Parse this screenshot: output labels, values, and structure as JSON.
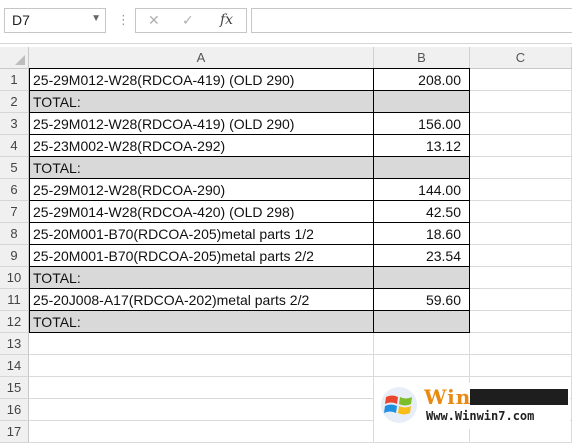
{
  "formula_bar": {
    "name_box": "D7",
    "cancel_symbol": "✕",
    "confirm_symbol": "✓",
    "fx_label": "fx",
    "formula": ""
  },
  "columns": [
    "A",
    "B",
    "C"
  ],
  "rows": [
    {
      "num": "1",
      "a": "25-29M012-W28(RDCOA-419)  (OLD 290)",
      "b": "208.00",
      "total": false
    },
    {
      "num": "2",
      "a": "TOTAL:",
      "b": "",
      "total": true
    },
    {
      "num": "3",
      "a": "25-29M012-W28(RDCOA-419)  (OLD 290)",
      "b": "156.00",
      "total": false
    },
    {
      "num": "4",
      "a": "25-23M002-W28(RDCOA-292)",
      "b": "13.12",
      "total": false
    },
    {
      "num": "5",
      "a": "TOTAL:",
      "b": "",
      "total": true
    },
    {
      "num": "6",
      "a": "25-29M012-W28(RDCOA-290)",
      "b": "144.00",
      "total": false
    },
    {
      "num": "7",
      "a": "25-29M014-W28(RDCOA-420) (OLD 298)",
      "b": "42.50",
      "total": false
    },
    {
      "num": "8",
      "a": "25-20M001-B70(RDCOA-205)metal parts 1/2",
      "b": "18.60",
      "total": false
    },
    {
      "num": "9",
      "a": "25-20M001-B70(RDCOA-205)metal parts 2/2",
      "b": "23.54",
      "total": false
    },
    {
      "num": "10",
      "a": "TOTAL:",
      "b": "",
      "total": true
    },
    {
      "num": "11",
      "a": "25-20J008-A17(RDCOA-202)metal parts 2/2",
      "b": "59.60",
      "total": false
    },
    {
      "num": "12",
      "a": "TOTAL:",
      "b": "",
      "total": true
    },
    {
      "num": "13",
      "a": "",
      "b": "",
      "total": false
    },
    {
      "num": "14",
      "a": "",
      "b": "",
      "total": false
    },
    {
      "num": "15",
      "a": "",
      "b": "",
      "total": false
    },
    {
      "num": "16",
      "a": "",
      "b": "",
      "total": false
    },
    {
      "num": "17",
      "a": "",
      "b": "",
      "total": false
    }
  ],
  "watermark": {
    "brand": "Win7",
    "url": "Www.Winwin7.com"
  },
  "colors": {
    "total_fill": "#d9d9d9",
    "header_fill": "#f0f0f0"
  }
}
